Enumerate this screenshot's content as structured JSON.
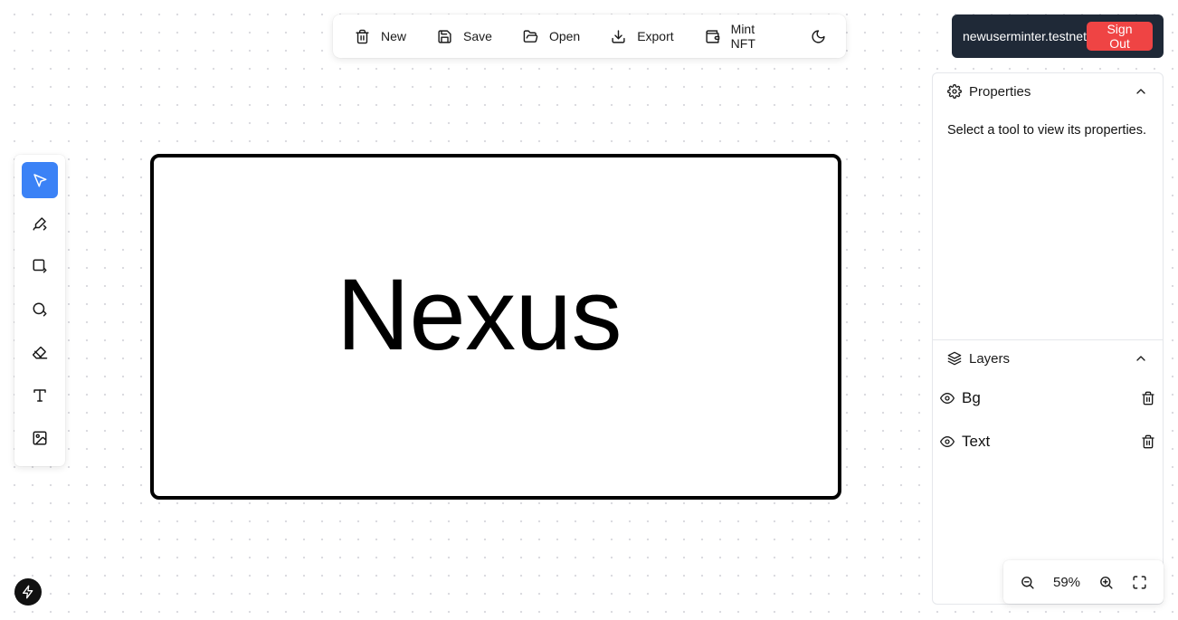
{
  "toolbar": {
    "new_label": "New",
    "save_label": "Save",
    "open_label": "Open",
    "export_label": "Export",
    "mint_label": "Mint NFT",
    "theme_icon": "moon-icon"
  },
  "user": {
    "account": "newuserminter.testnet",
    "signout_label": "Sign Out"
  },
  "tools": [
    {
      "name": "select",
      "icon": "cursor-icon",
      "active": true
    },
    {
      "name": "brush",
      "icon": "brush-icon"
    },
    {
      "name": "rectangle",
      "icon": "square-icon"
    },
    {
      "name": "ellipse",
      "icon": "circle-icon"
    },
    {
      "name": "eraser",
      "icon": "eraser-icon"
    },
    {
      "name": "text",
      "icon": "type-icon"
    },
    {
      "name": "image",
      "icon": "image-icon"
    }
  ],
  "canvas": {
    "text": "Nexus"
  },
  "properties": {
    "title": "Properties",
    "empty_message": "Select a tool to view its properties."
  },
  "layers": {
    "title": "Layers",
    "items": [
      {
        "name": "Bg"
      },
      {
        "name": "Text"
      }
    ]
  },
  "zoom": {
    "value": "59%"
  },
  "colors": {
    "accent": "#3b82f6",
    "signout": "#ef4444",
    "userbox": "#1f2937"
  }
}
